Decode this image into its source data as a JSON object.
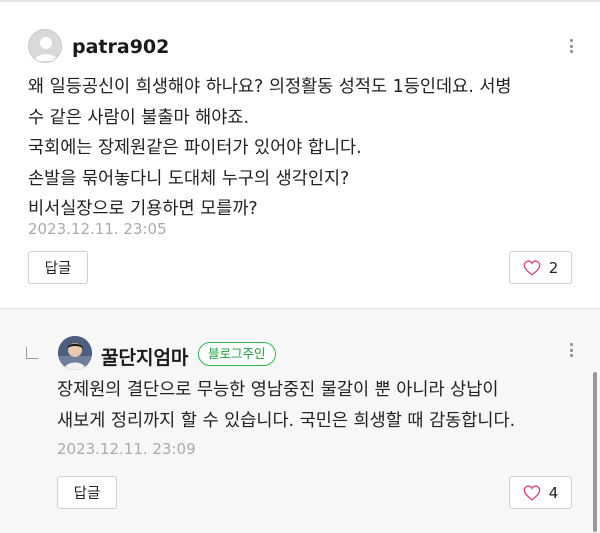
{
  "comments": [
    {
      "author": "patra902",
      "lines": [
        "왜 일등공신이 희생해야 하나요? 의정활동 성적도 1등인데요. 서병",
        "수 같은 사람이 불출마 해야죠.",
        "국회에는 장제원같은 파이터가 있어야 합니다.",
        "손발을 묶어놓다니 도대체 누구의 생각인지?",
        "비서실장으로 기용하면 모를까?"
      ],
      "date": "2023.12.11. 23:05",
      "reply_label": "답글",
      "likes": "2"
    }
  ],
  "reply": {
    "author": "꿀단지엄마",
    "badge": "블로그주인",
    "lines": [
      "장제원의 결단으로 무능한 영남중진 물갈이 뿐 아니라 상납이",
      "새보게 정리까지 할 수 있습니다. 국민은 희생할 때 감동합니다."
    ],
    "date": "2023.12.11. 23:09",
    "reply_label": "답글",
    "likes": "4"
  },
  "colors": {
    "badge_green": "#2fb54d",
    "heart_pink": "#e0457b",
    "date_gray": "#aaaaaa"
  },
  "icons": [
    "default-avatar-icon",
    "more-vertical-icon",
    "reply-arrow-icon",
    "heart-icon"
  ]
}
